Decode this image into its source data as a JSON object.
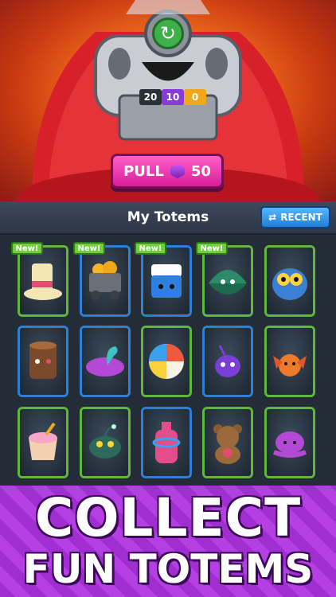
{
  "machine": {
    "counters": [
      "20",
      "10",
      "0"
    ],
    "pull_label": "PULL",
    "pull_cost": "50",
    "colors": {
      "counter1": "#2a2f38",
      "counter2": "#8a3ad6",
      "counter3": "#f0a818"
    }
  },
  "header": {
    "title": "My Totems",
    "recent_label": "RECENT"
  },
  "badges": {
    "new": "New!"
  },
  "banner": {
    "line1": "COLLECT",
    "line2": "FUN TOTEMS"
  }
}
